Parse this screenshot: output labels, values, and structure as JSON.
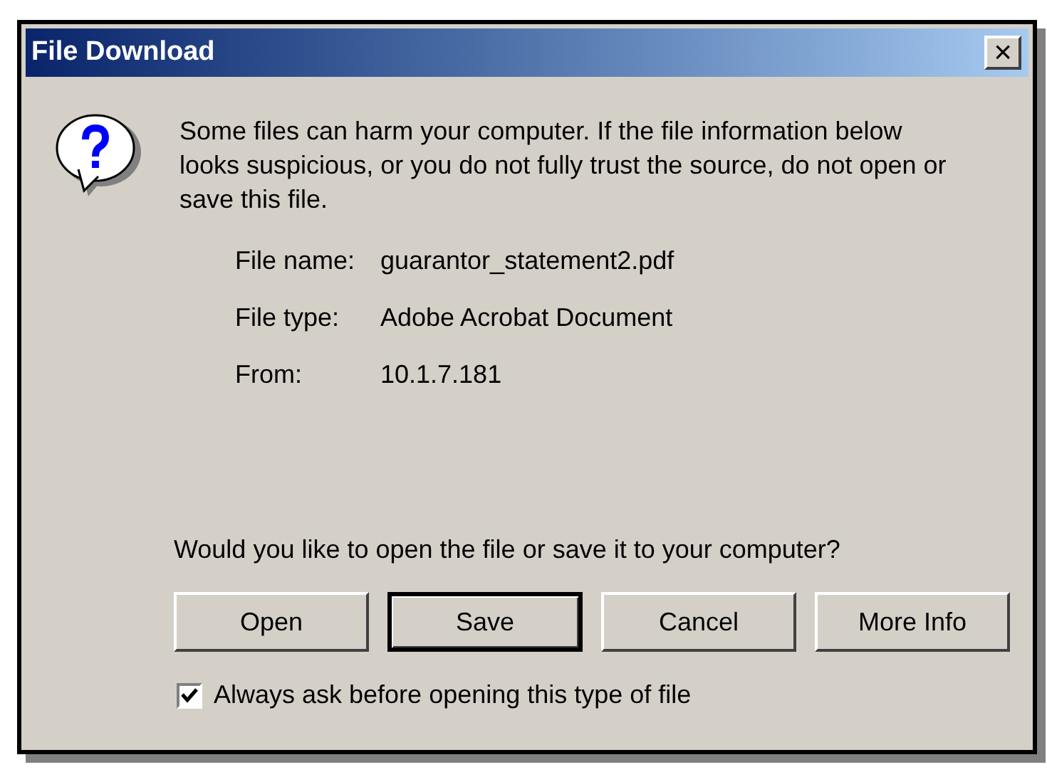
{
  "window": {
    "title": "File Download",
    "close": "×"
  },
  "message": "Some files can harm your computer. If the file information below looks suspicious, or you do not fully trust the source, do not open or save this file.",
  "file_info": [
    {
      "label": "File name:",
      "value": "guarantor_statement2.pdf"
    },
    {
      "label": "File type:",
      "value": "Adobe Acrobat Document"
    },
    {
      "label": "From:",
      "value": "10.1.7.181"
    }
  ],
  "question": "Would you like to open the file or save it to your computer?",
  "buttons": [
    {
      "label": "Open",
      "default": false
    },
    {
      "label": "Save",
      "default": true
    },
    {
      "label": "Cancel",
      "default": false
    },
    {
      "label": "More Info",
      "default": false
    }
  ],
  "checkbox": {
    "label": "Always ask before opening this type of file",
    "checked": true
  }
}
